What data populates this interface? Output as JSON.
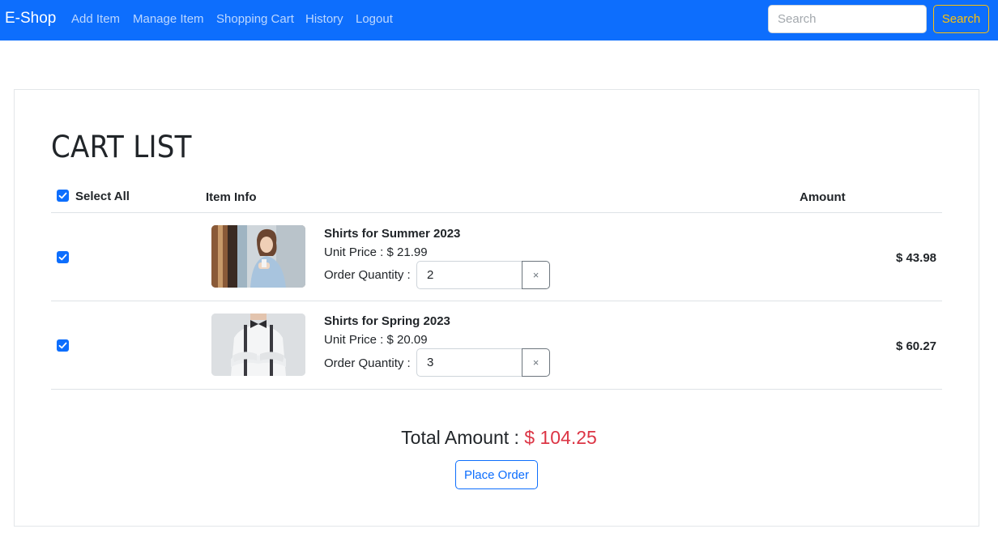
{
  "navbar": {
    "brand": "E-Shop",
    "links": [
      "Add Item",
      "Manage Item",
      "Shopping Cart",
      "History",
      "Logout"
    ],
    "search_placeholder": "Search",
    "search_button": "Search"
  },
  "cart": {
    "title": "CART LIST",
    "headers": {
      "select_all": "Select All",
      "item_info": "Item Info",
      "amount": "Amount"
    },
    "select_all_checked": true,
    "items": [
      {
        "checked": true,
        "image": "woman-in-shirt-photo",
        "name": "Shirts for Summer 2023",
        "unit_price": "Unit Price : $ 21.99",
        "qty_label": "Order Quantity :",
        "quantity": "2",
        "clear_symbol": "×",
        "amount": "$ 43.98"
      },
      {
        "checked": true,
        "image": "man-in-shirt-photo",
        "name": "Shirts for Spring 2023",
        "unit_price": "Unit Price : $ 20.09",
        "qty_label": "Order Quantity :",
        "quantity": "3",
        "clear_symbol": "×",
        "amount": "$ 60.27"
      }
    ],
    "total_label": "Total Amount :",
    "total_value": "$ 104.25",
    "place_order": "Place Order"
  },
  "colors": {
    "primary": "#0d6efd",
    "warning": "#ffc107",
    "danger": "#dc3545"
  }
}
